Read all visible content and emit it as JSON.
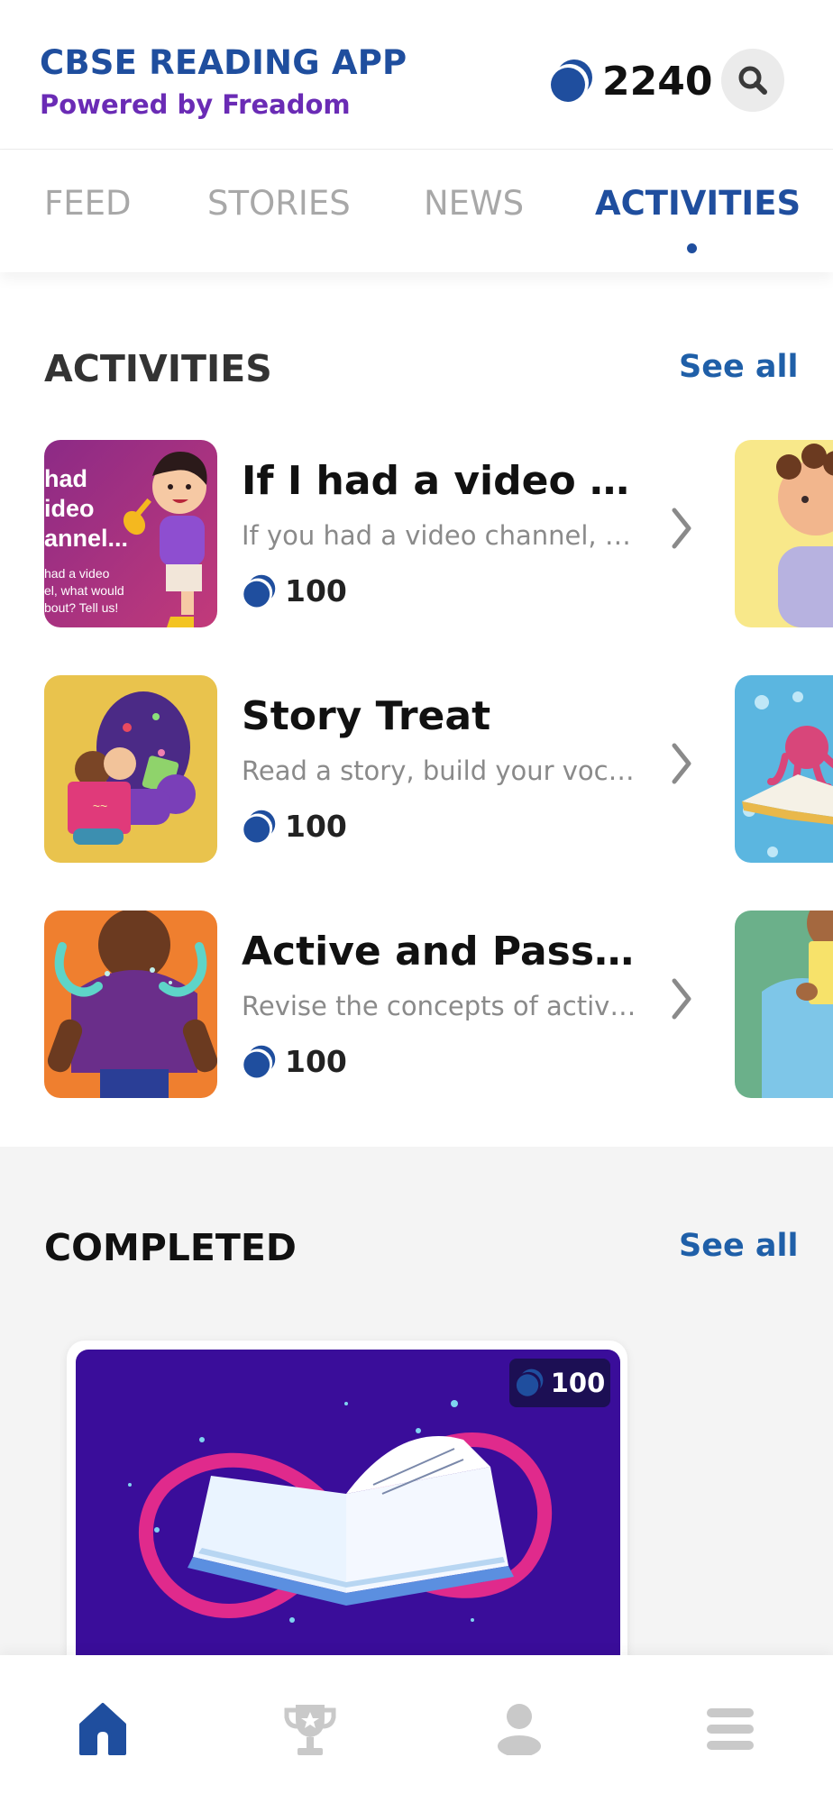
{
  "header": {
    "app_title": "CBSE READING APP",
    "subtitle": "Powered by Freadom",
    "coin_balance": "2240",
    "search_icon": "search-icon",
    "coin_icon": "coin-icon"
  },
  "tabs": [
    {
      "label": "FEED",
      "active": false
    },
    {
      "label": "STORIES",
      "active": false
    },
    {
      "label": "NEWS",
      "active": false
    },
    {
      "label": "ACTIVITIES",
      "active": true
    }
  ],
  "activities": {
    "title": "ACTIVITIES",
    "see_all": "See all",
    "items": [
      {
        "title": "If I had a video cha...",
        "description": "If you had a video channel, wh...",
        "coins": "100",
        "thumb_text": [
          "had",
          "ideo",
          "annel...",
          "had a video",
          "el, what would",
          "bout? Tell us!"
        ]
      },
      {
        "title": "Story Treat",
        "description": "Read a story, build your vocab...",
        "coins": "100"
      },
      {
        "title": "Active and Passive...",
        "description": "Revise the concepts of active...",
        "coins": "100"
      }
    ]
  },
  "completed": {
    "title": "COMPLETED",
    "see_all": "See all",
    "card_coins": "100"
  },
  "bottom_nav": [
    {
      "icon": "home-icon",
      "active": true
    },
    {
      "icon": "trophy-icon",
      "active": false
    },
    {
      "icon": "profile-icon",
      "active": false
    },
    {
      "icon": "menu-icon",
      "active": false
    }
  ],
  "colors": {
    "brand_blue": "#1f4e9e",
    "brand_purple": "#6a2bb5",
    "link_blue": "#1f5fa8",
    "inactive_gray": "#a8a8a8"
  }
}
